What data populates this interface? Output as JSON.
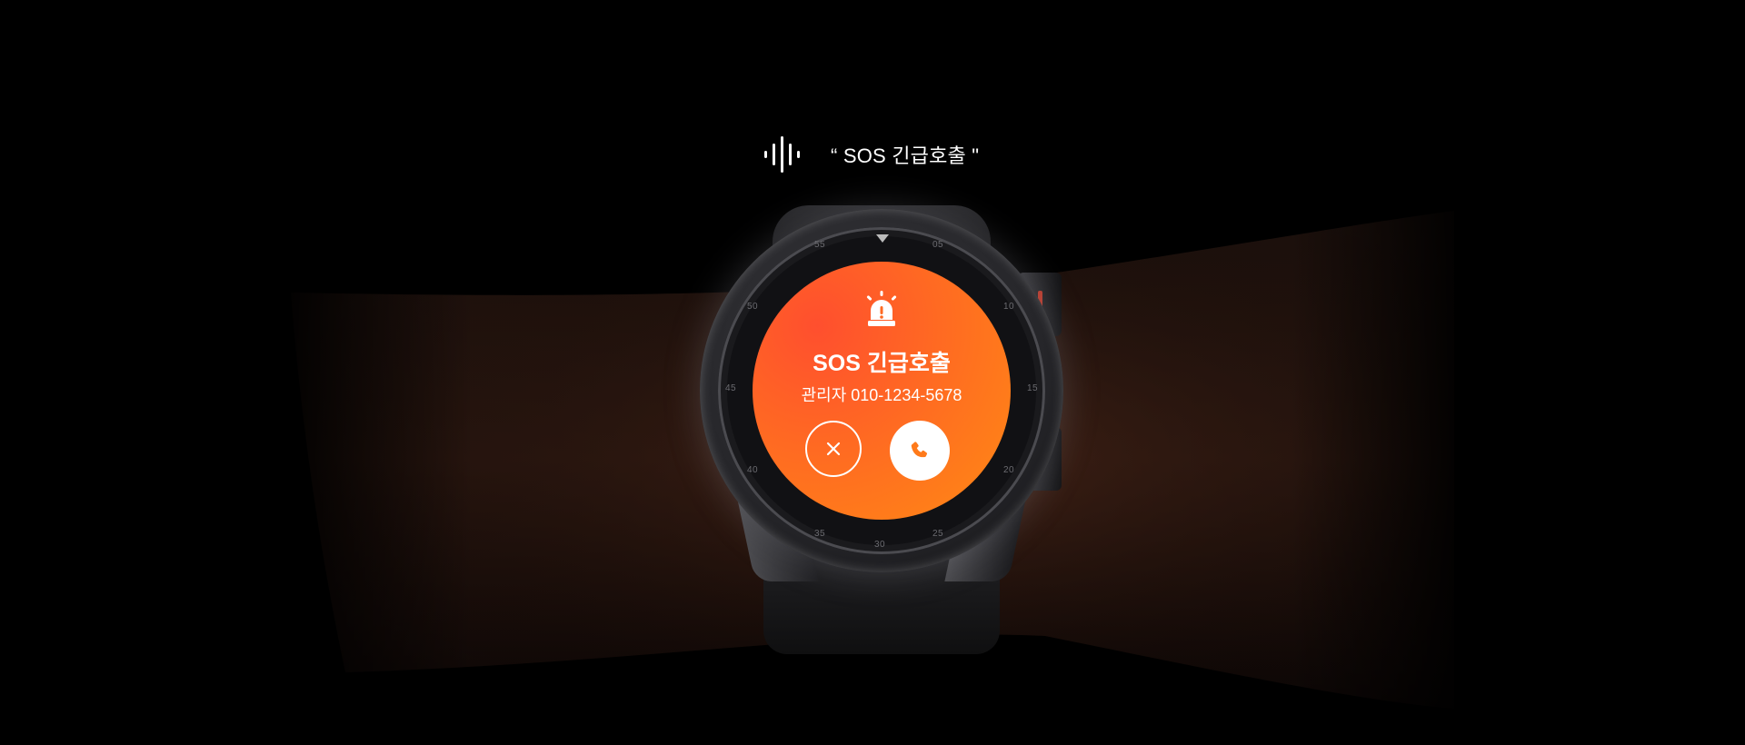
{
  "voice_prompt": {
    "icon": "voice-wave-icon",
    "text": "“ SOS 긴급호출 \""
  },
  "watch_screen": {
    "alert_icon": "siren-icon",
    "title": "SOS 긴급호출",
    "caller": "관리자 010-1234-5678",
    "decline_icon": "close-icon",
    "accept_icon": "phone-icon"
  },
  "bezel_numbers": [
    "05",
    "10",
    "15",
    "20",
    "25",
    "30",
    "35",
    "40",
    "45",
    "50",
    "55"
  ],
  "colors": {
    "background": "#000000",
    "screen_gradient_start": "#ff4f2e",
    "screen_gradient_end": "#ff8a14",
    "button": "#ffffff"
  }
}
